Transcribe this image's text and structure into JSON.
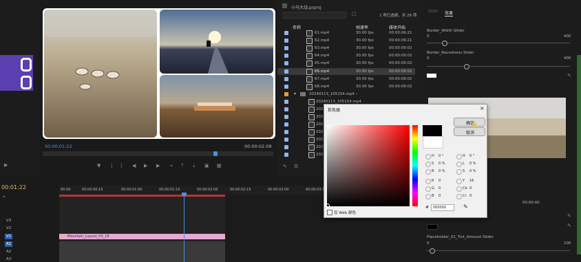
{
  "program_monitor": {
    "timecode_left": "00:00:01:22",
    "timecode_right": "00:00:02:09"
  },
  "project_panel": {
    "project_name": "小马大战.prproj",
    "selection_info": "1 项已选择，共 28 项",
    "columns": [
      "名称",
      "帧速率",
      "媒体开始"
    ],
    "files": [
      {
        "name": "61.mp4",
        "fps": "30.00 fps",
        "start": "00:00:06:21"
      },
      {
        "name": "62.mp4",
        "fps": "30.00 fps",
        "start": "00:00:09:21"
      },
      {
        "name": "63.mp4",
        "fps": "30.00 fps",
        "start": "00:00:09:02"
      },
      {
        "name": "64.mp4",
        "fps": "30.00 fps",
        "start": "00:00:09:02"
      },
      {
        "name": "65.mp4",
        "fps": "30.00 fps",
        "start": "00:00:09:02"
      },
      {
        "name": "66.mp4",
        "fps": "30.00 fps",
        "start": "00:00:09:02"
      },
      {
        "name": "67.mp4",
        "fps": "30.00 fps",
        "start": "00:00:09:02"
      },
      {
        "name": "68.mp4",
        "fps": "30.00 fps",
        "start": "00:00:09:02"
      }
    ],
    "folder": "20240113_105154.mp4 –",
    "subfiles": [
      "20240113_105154.mp4",
      "202",
      "202",
      "202",
      "202",
      "202",
      "202",
      "202"
    ]
  },
  "color_picker": {
    "title": "拾色器",
    "ok_label": "确定",
    "cancel_label": "取消",
    "web_colors_label": "仅 Web 颜色",
    "hex_value": "000000",
    "left_fields": [
      {
        "label": "H",
        "value": "0 °"
      },
      {
        "label": "S",
        "value": "0 %"
      },
      {
        "label": "B",
        "value": "0 %"
      },
      {
        "label": "R",
        "value": "0"
      },
      {
        "label": "G",
        "value": "0"
      },
      {
        "label": "B",
        "value": "0"
      }
    ],
    "right_fields": [
      {
        "label": "H",
        "value": "0 °"
      },
      {
        "label": "L",
        "value": "0 %"
      },
      {
        "label": "S",
        "value": "0 %"
      },
      {
        "label": "Y",
        "value": "16"
      },
      {
        "label": "Cb",
        "value": "0"
      },
      {
        "label": "Cr",
        "value": "0"
      }
    ]
  },
  "effect_controls": {
    "tab_label": "效果",
    "border_width_label": "Border_Width Slider",
    "border_width_min": "0",
    "border_width_max": "400",
    "border_roundness_label": "Border_Roundness Slider",
    "border_roundness_min": "0",
    "border_roundness_max": "400",
    "placeholder_label": "Placeholder_01_Tint_Amount Slider",
    "placeholder_min": "0",
    "placeholder_max": "100",
    "timecode": "00:00:00"
  },
  "timeline": {
    "current_time": "00:01:22",
    "ruler": [
      "00:00",
      "00:00:00:15",
      "00:00:01:00",
      "00:00:01:15",
      "00:00:02:00",
      "00:00:02:15",
      "00:00:03:00",
      "00:00:03:15"
    ],
    "tracks": [
      "V3",
      "V2",
      "V1",
      "A1",
      "A2",
      "A3"
    ],
    "clip_label": "Mountain_Layout_03_18"
  }
}
